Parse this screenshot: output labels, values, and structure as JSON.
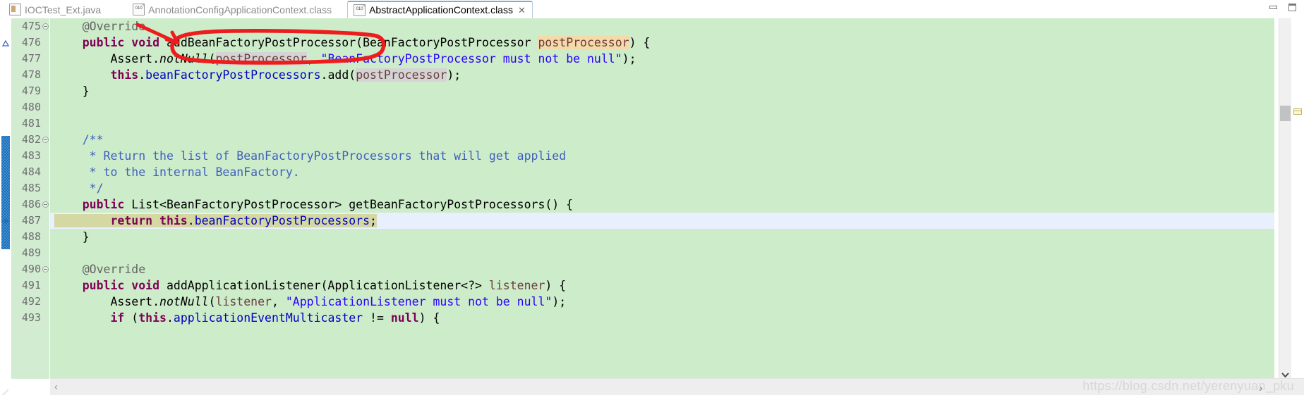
{
  "window": {
    "minimize_label": "minimize",
    "restore_label": "restore"
  },
  "tabs": [
    {
      "label": "IOCTest_Ext.java",
      "icon": "java-file-icon",
      "active": false,
      "closable": false
    },
    {
      "label": "AnnotationConfigApplicationContext.class",
      "icon": "class-file-icon",
      "active": false,
      "closable": false
    },
    {
      "label": "AbstractApplicationContext.class",
      "icon": "class-file-icon",
      "active": true,
      "closable": true,
      "close_glyph": "✕"
    }
  ],
  "editor": {
    "first_line": 475,
    "current_line": 487,
    "fold_lines": [
      475,
      482,
      486,
      490
    ],
    "change_bar_lines": [
      482,
      483,
      484,
      485,
      486,
      487,
      488
    ],
    "override_marker_line": 476,
    "arrow_marker_line": 487,
    "lines": [
      {
        "n": 475,
        "text": "    @Override"
      },
      {
        "n": 476,
        "text": "    public void addBeanFactoryPostProcessor(BeanFactoryPostProcessor postProcessor) {"
      },
      {
        "n": 477,
        "text": "        Assert.notNull(postProcessor, \"BeanFactoryPostProcessor must not be null\");"
      },
      {
        "n": 478,
        "text": "        this.beanFactoryPostProcessors.add(postProcessor);"
      },
      {
        "n": 479,
        "text": "    }"
      },
      {
        "n": 480,
        "text": ""
      },
      {
        "n": 481,
        "text": ""
      },
      {
        "n": 482,
        "text": "    /**"
      },
      {
        "n": 483,
        "text": "     * Return the list of BeanFactoryPostProcessors that will get applied"
      },
      {
        "n": 484,
        "text": "     * to the internal BeanFactory."
      },
      {
        "n": 485,
        "text": "     */"
      },
      {
        "n": 486,
        "text": "    public List<BeanFactoryPostProcessor> getBeanFactoryPostProcessors() {"
      },
      {
        "n": 487,
        "text": "        return this.beanFactoryPostProcessors;"
      },
      {
        "n": 488,
        "text": "    }"
      },
      {
        "n": 489,
        "text": ""
      },
      {
        "n": 490,
        "text": "    @Override"
      },
      {
        "n": 491,
        "text": "    public void addApplicationListener(ApplicationListener<?> listener) {"
      },
      {
        "n": 492,
        "text": "        Assert.notNull(listener, \"ApplicationListener must not be null\");"
      },
      {
        "n": 493,
        "text": "        if (this.applicationEventMulticaster != null) {"
      }
    ]
  },
  "annotation": {
    "shape": "red-ellipse-with-arrow",
    "target_text": "addBeanFactoryPostProcessor",
    "color": "#ee1c1c"
  },
  "colors": {
    "editor_background": "#cdecca",
    "gutter_background": "#d2ecd2",
    "current_line": "#e8f0fd",
    "selection": "#d4d9a4",
    "param_highlight": "#f5d9a8",
    "occurrence_highlight": "#d4d4d4",
    "keyword": "#7f0055",
    "string": "#2a00ff",
    "comment": "#3f5fbf",
    "field": "#0000c0",
    "local_var": "#6a3e3e",
    "annotation_red": "#ee1c1c"
  },
  "scrollbars": {
    "vertical_thumb_visible": true,
    "horizontal_left_glyph": "‹",
    "horizontal_right_glyph": "›",
    "overview_marker_visible": true,
    "scroll_down_glyph": "⌄"
  },
  "watermark": {
    "text": "https://blog.csdn.net/yerenyuan_pku"
  }
}
